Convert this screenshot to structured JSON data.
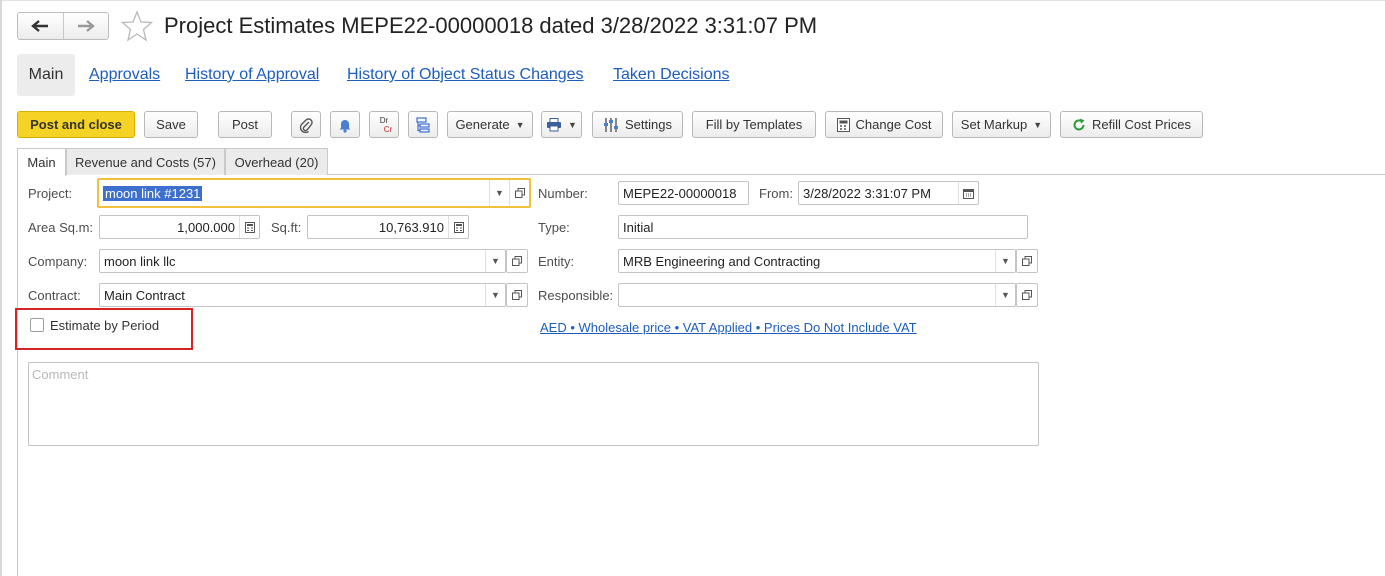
{
  "window": {
    "title": "Project Estimates MEPE22-00000018 dated 3/28/2022 3:31:07 PM"
  },
  "nav": {
    "back_icon": "arrow-left-icon",
    "forward_icon": "arrow-right-icon",
    "favorite_icon": "star-icon"
  },
  "top_links": [
    {
      "label": "Main"
    },
    {
      "label": "Approvals"
    },
    {
      "label": "History of Approval"
    },
    {
      "label": "History of Object Status Changes"
    },
    {
      "label": "Taken Decisions"
    }
  ],
  "toolbar": {
    "post_and_close": "Post and close",
    "save": "Save",
    "post": "Post",
    "generate": "Generate",
    "settings": "Settings",
    "fill_by_templates": "Fill by Templates",
    "change_cost": "Change Cost",
    "set_markup": "Set Markup",
    "refill_cost_prices": "Refill Cost Prices",
    "dr_label": "Dr",
    "cr_label": "Cr"
  },
  "form_tabs": [
    {
      "label": "Main"
    },
    {
      "label": "Revenue and Costs (57)"
    },
    {
      "label": "Overhead (20)"
    }
  ],
  "form": {
    "project": {
      "label": "Project:",
      "value": "moon link #1231"
    },
    "area_sqm": {
      "label": "Area Sq.m:",
      "value": "1,000.000"
    },
    "sqft": {
      "label": "Sq.ft:",
      "value": "10,763.910"
    },
    "company": {
      "label": "Company:",
      "value": "moon link llc"
    },
    "contract": {
      "label": "Contract:",
      "value": "Main Contract"
    },
    "estimate_by_period": {
      "label": "Estimate by Period",
      "checked": false
    },
    "number": {
      "label": "Number:",
      "value": "MEPE22-00000018"
    },
    "from": {
      "label": "From:",
      "value": "3/28/2022  3:31:07 PM"
    },
    "type": {
      "label": "Type:",
      "value": "Initial"
    },
    "entity": {
      "label": "Entity:",
      "value": "MRB Engineering and Contracting"
    },
    "responsible": {
      "label": "Responsible:",
      "value": ""
    },
    "price_settings_link": "AED • Wholesale price • VAT Applied • Prices Do Not Include VAT",
    "comment": {
      "placeholder": "Comment",
      "value": ""
    }
  },
  "colors": {
    "primary_button": "#f5d324",
    "link": "#1c5dbd",
    "highlight_box": "#d62424",
    "focus_border": "#f0c23b",
    "selection": "#3d6fcf"
  }
}
